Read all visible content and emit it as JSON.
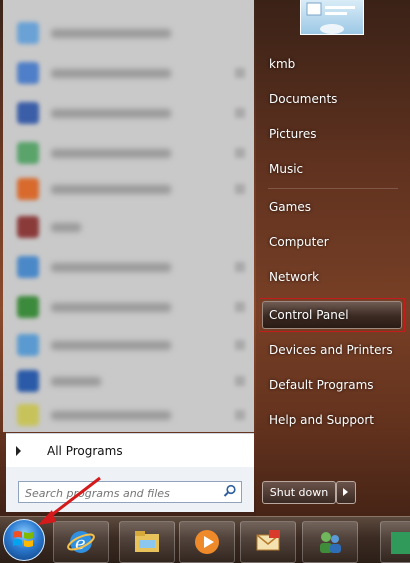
{
  "user": {
    "name": "kmb"
  },
  "right_menu": {
    "items": [
      {
        "label": "kmb"
      },
      {
        "label": "Documents"
      },
      {
        "label": "Pictures"
      },
      {
        "label": "Music"
      },
      {
        "label": "Games"
      },
      {
        "label": "Computer"
      },
      {
        "label": "Network"
      },
      {
        "label": "Control Panel"
      },
      {
        "label": "Devices and Printers"
      },
      {
        "label": "Default Programs"
      },
      {
        "label": "Help and Support"
      }
    ],
    "selected": "Control Panel"
  },
  "all_programs": {
    "label": "All Programs"
  },
  "search": {
    "placeholder": "Search programs and files"
  },
  "shutdown": {
    "label": "Shut down"
  },
  "taskbar": {
    "pinned": [
      "internet-explorer-icon",
      "explorer-icon",
      "media-player-icon",
      "outlook-icon",
      "users-icon"
    ]
  },
  "colors": {
    "highlight_border": "#c21c1c",
    "annotation_arrow": "#d41a1a"
  }
}
